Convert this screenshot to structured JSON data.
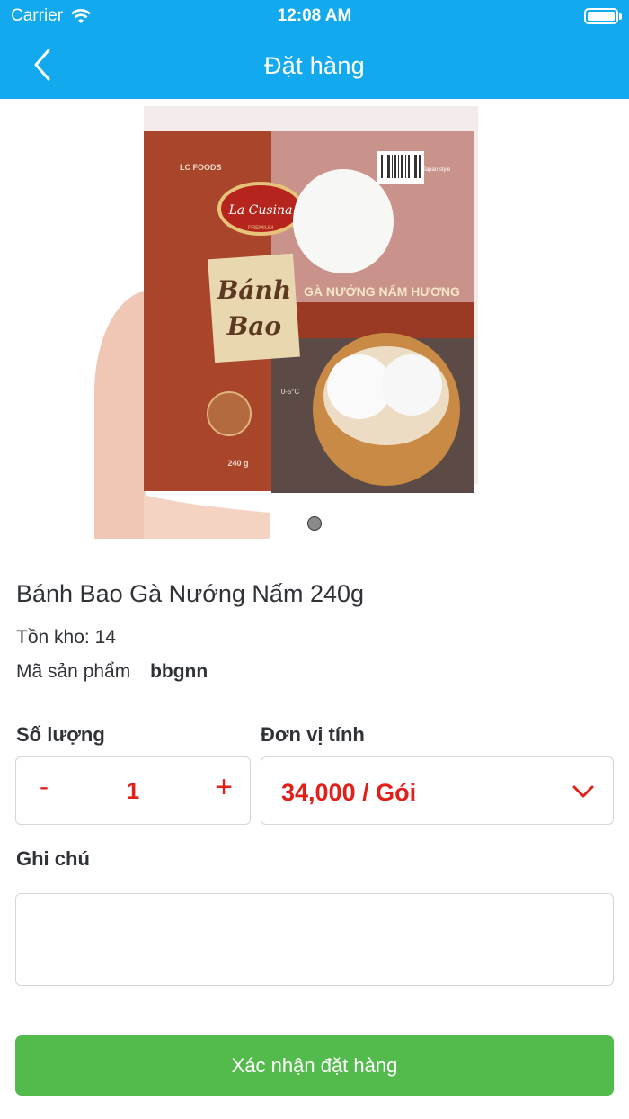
{
  "status_bar": {
    "carrier": "Carrier",
    "time": "12:08 AM"
  },
  "nav": {
    "title": "Đặt hàng",
    "back_icon": "chevron-left-icon"
  },
  "product": {
    "name": "Bánh Bao Gà Nướng Nấm 240g",
    "stock_label": "Tồn kho:",
    "stock_value": "14",
    "sku_label": "Mã sản phẩm",
    "sku_value": "bbgnn",
    "image": {
      "brand_top": "LC FOODS",
      "logo": "La Cusina",
      "logo_sub": "PREMIUM",
      "big_text_1": "Bánh",
      "big_text_2": "Bao",
      "flavor": "GÀ NƯỚNG NẤM HƯƠNG",
      "weight": "240 g",
      "temp": "0-5°C",
      "badge": "Japan style"
    }
  },
  "form": {
    "quantity_label": "Số lượng",
    "quantity_value": "1",
    "minus": "-",
    "plus": "+",
    "unit_label": "Đơn vị tính",
    "unit_value": "34,000 / Gói",
    "note_label": "Ghi chú",
    "note_value": ""
  },
  "actions": {
    "confirm_label": "Xác nhận đặt hàng"
  },
  "colors": {
    "header": "#12a9ee",
    "accent_red": "#e0201b",
    "confirm_green": "#52bb4c"
  }
}
